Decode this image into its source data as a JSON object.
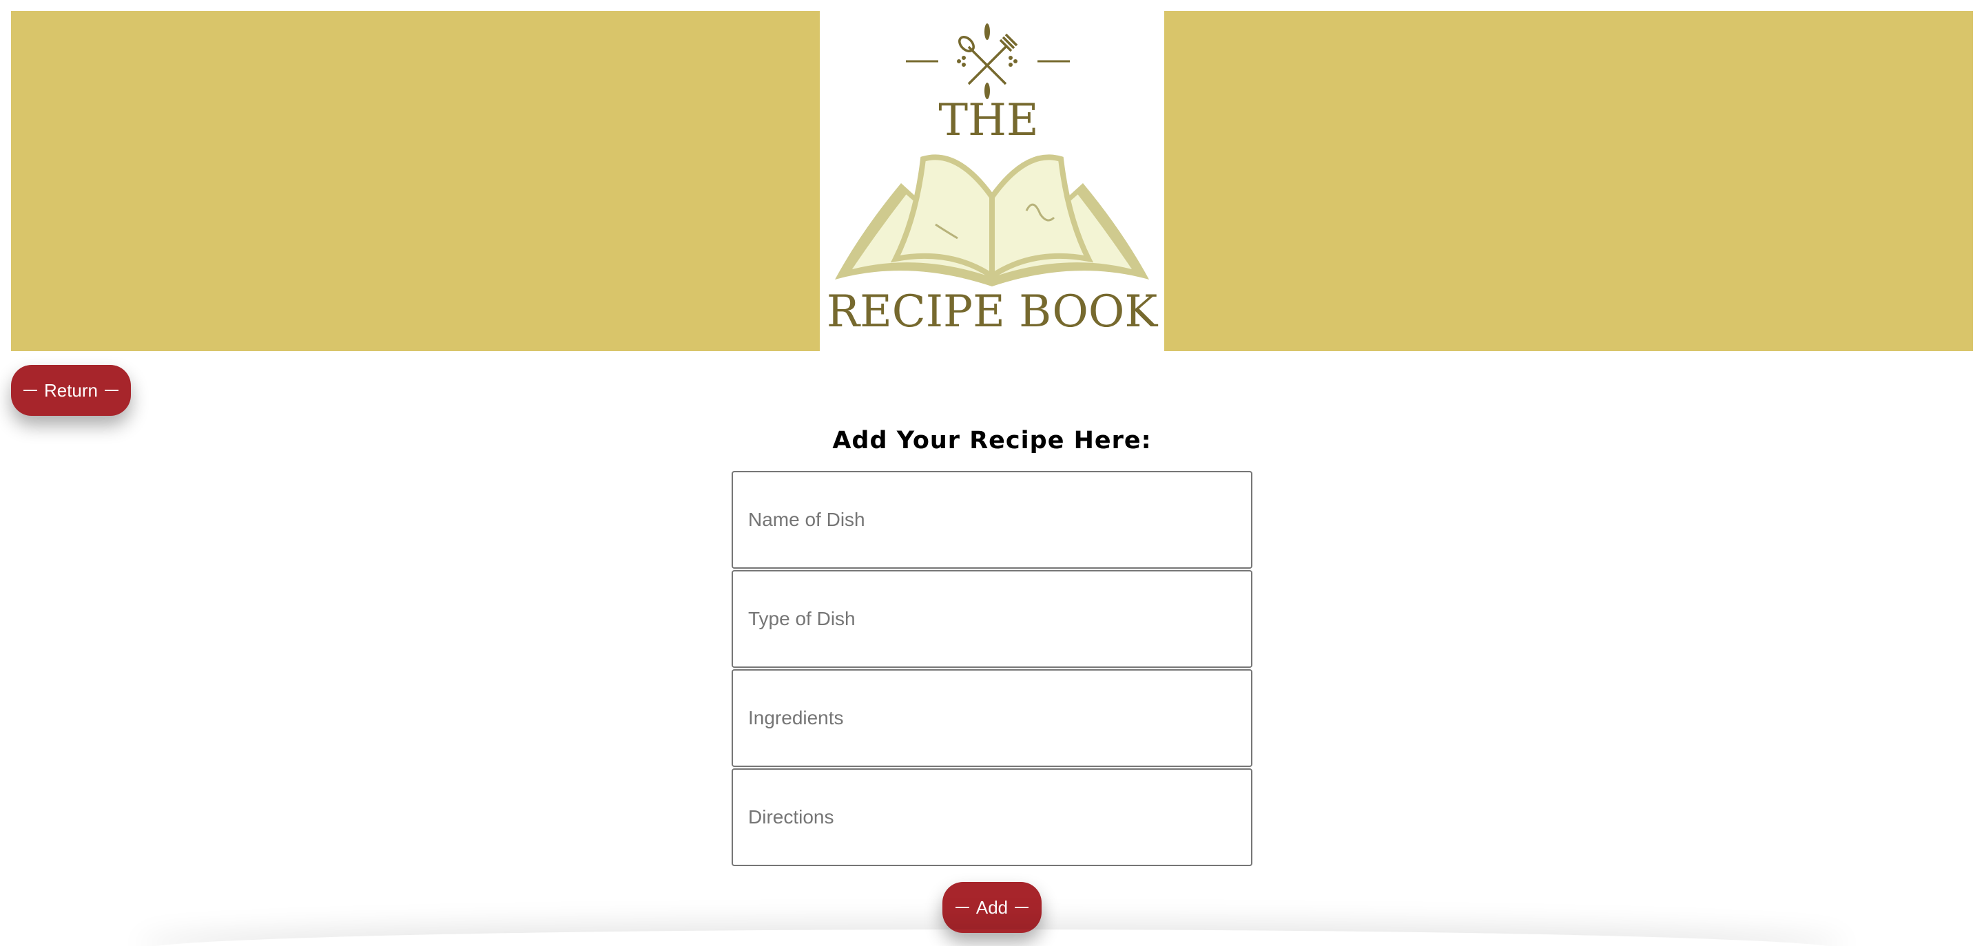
{
  "header": {
    "banner_color": "#d9c56a",
    "logo": {
      "line1": "THE",
      "line2": "RECIPE BOOK",
      "text_color": "#76692e",
      "icon": "crossed-spoon-fork-book-logo"
    }
  },
  "nav": {
    "return_label": "Return",
    "button_color": "#a7252b"
  },
  "form": {
    "title": "Add Your Recipe Here:",
    "fields": [
      {
        "placeholder": "Name of Dish",
        "value": ""
      },
      {
        "placeholder": "Type of Dish",
        "value": ""
      },
      {
        "placeholder": "Ingredients",
        "value": ""
      },
      {
        "placeholder": "Directions",
        "value": ""
      }
    ],
    "submit_label": "Add"
  }
}
